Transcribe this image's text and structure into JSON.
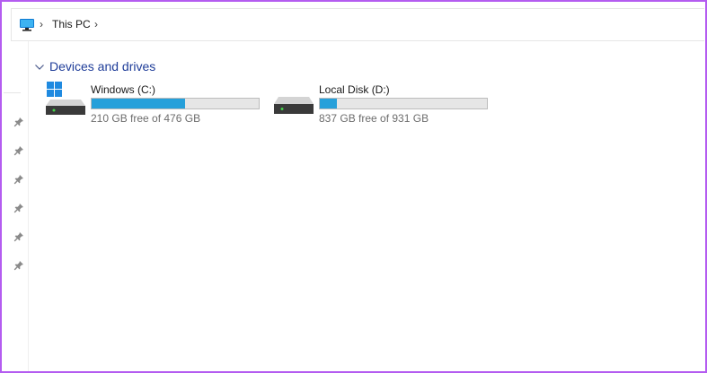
{
  "breadcrumb": {
    "location_icon": "this-pc-monitor-icon",
    "items": [
      "This PC"
    ]
  },
  "left_pane": {
    "pinned_icon": "pin-icon",
    "pinned_count": 6
  },
  "section": {
    "title": "Devices and drives",
    "expanded": true
  },
  "drives": [
    {
      "name": "Windows (C:)",
      "icon": "windows-drive-icon",
      "free_text": "210 GB free of 476 GB",
      "used_fraction": 0.559
    },
    {
      "name": "Local Disk (D:)",
      "icon": "hard-drive-icon",
      "free_text": "837 GB free of 931 GB",
      "used_fraction": 0.101
    }
  ],
  "colors": {
    "accent_border": "#b45cf0",
    "section_title": "#1f3d99",
    "bar_fill": "#26a0da",
    "bar_track": "#e6e6e6"
  }
}
